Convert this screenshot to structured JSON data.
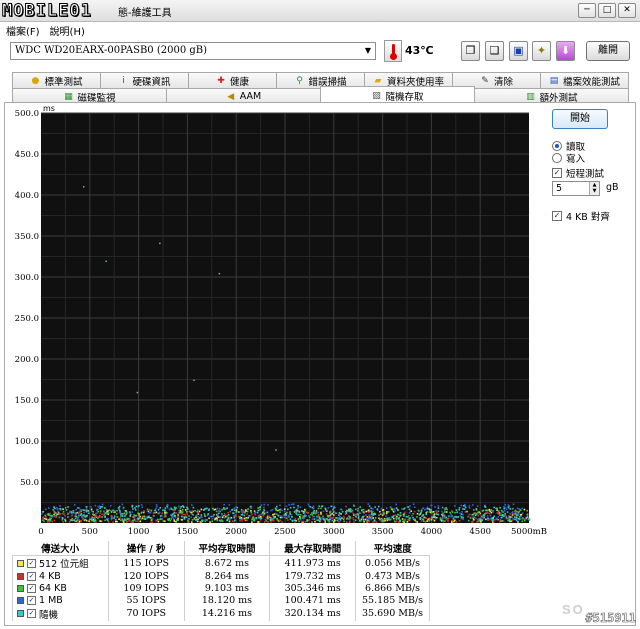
{
  "window": {
    "logo": "MOBILE01",
    "title": "態-維護工具",
    "buttons": [
      "─",
      "□",
      "✕"
    ]
  },
  "menu": [
    "檔案(F)",
    "說明(H)"
  ],
  "toolbar": {
    "drive": "WDC WD20EARX-00PASB0 (2000 gB)",
    "temperature": "43℃",
    "exit_label": "離開",
    "tool_icons": [
      "copy-text-icon",
      "copy-image-icon",
      "save-icon",
      "options-icon",
      "download-icon"
    ]
  },
  "tabs_row1": [
    {
      "label": "標準測試",
      "icon": "benchmark-icon"
    },
    {
      "label": "硬碟資訊",
      "icon": "info-icon"
    },
    {
      "label": "健康",
      "icon": "health-icon"
    },
    {
      "label": "錯誤掃描",
      "icon": "error-scan-icon"
    },
    {
      "label": "資料夾使用率",
      "icon": "folder-usage-icon"
    },
    {
      "label": "清除",
      "icon": "erase-icon"
    },
    {
      "label": "檔案效能測試",
      "icon": "file-benchmark-icon"
    }
  ],
  "tabs_row2": [
    {
      "label": "磁碟監視",
      "icon": "disk-monitor-icon"
    },
    {
      "label": "AAM",
      "icon": "speaker-icon"
    },
    {
      "label": "隨機存取",
      "icon": "random-access-icon",
      "active": true
    },
    {
      "label": "額外測試",
      "icon": "extra-tests-icon"
    }
  ],
  "side": {
    "start_label": "開始",
    "read_label": "讀取",
    "write_label": "寫入",
    "mode": "read",
    "short_test_label": "短程測試",
    "short_test_checked": true,
    "size_value": "5",
    "size_unit": "gB",
    "align_label": "4 KB 對齊",
    "align_checked": true
  },
  "chart_data": {
    "type": "scatter",
    "ylabel": "ms",
    "xlabel": "",
    "y_ticks": [
      "500.0",
      "450.0",
      "400.0",
      "350.0",
      "300.0",
      "250.0",
      "200.0",
      "150.0",
      "100.0",
      "50.0"
    ],
    "x_ticks": [
      "0",
      "500",
      "1000",
      "1500",
      "2000",
      "2500",
      "3000",
      "3500",
      "4000",
      "4500",
      "5000mB"
    ],
    "ylim": [
      0,
      500
    ],
    "xlim": [
      0,
      5000
    ],
    "grid": true,
    "background": "#101010",
    "series": [
      {
        "name": "512 位元組",
        "color": "#f2e94e",
        "band": [
          2,
          18
        ]
      },
      {
        "name": "4 KB",
        "color": "#c8322a",
        "band": [
          2,
          16
        ]
      },
      {
        "name": "64 KB",
        "color": "#3fbf3f",
        "band": [
          3,
          20
        ]
      },
      {
        "name": "1 MB",
        "color": "#2f63d8",
        "band": [
          5,
          24
        ]
      },
      {
        "name": "隨機",
        "color": "#35c9c9",
        "band": [
          4,
          22
        ]
      }
    ],
    "outliers": [
      [
        430,
        411
      ],
      [
        1210,
        342
      ],
      [
        660,
        320
      ],
      [
        1560,
        175
      ],
      [
        980,
        160
      ],
      [
        2400,
        90
      ],
      [
        1820,
        305
      ]
    ]
  },
  "stats": {
    "headers": [
      "傳送大小",
      "操作 / 秒",
      "平均存取時間",
      "最大存取時間",
      "平均速度"
    ],
    "rows": [
      {
        "label": "512 位元組",
        "color": "#f2e94e",
        "ops": "115 IOPS",
        "avg": "8.672 ms",
        "max": "411.973 ms",
        "speed": "0.056 MB/s"
      },
      {
        "label": "4 KB",
        "color": "#c8322a",
        "ops": "120 IOPS",
        "avg": "8.264 ms",
        "max": "179.732 ms",
        "speed": "0.473 MB/s"
      },
      {
        "label": "64 KB",
        "color": "#3fbf3f",
        "ops": "109 IOPS",
        "avg": "9.103 ms",
        "max": "305.346 ms",
        "speed": "6.866 MB/s"
      },
      {
        "label": "1 MB",
        "color": "#2f63d8",
        "ops": "55 IOPS",
        "avg": "18.120 ms",
        "max": "100.471 ms",
        "speed": "55.185 MB/s"
      },
      {
        "label": "隨機",
        "color": "#35c9c9",
        "ops": "70 IOPS",
        "avg": "14.216 ms",
        "max": "320.134 ms",
        "speed": "35.690 MB/s"
      }
    ]
  },
  "watermark": "#515911",
  "watermark_soft": "SO",
  "colors": {
    "accent": "#3b7ec1",
    "chart_bg": "#101010",
    "grid": "#3c3c3c"
  }
}
